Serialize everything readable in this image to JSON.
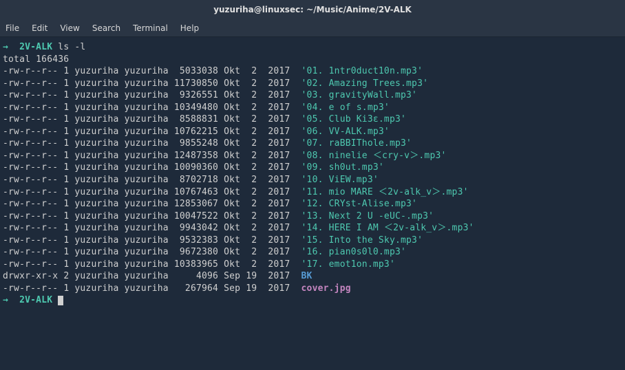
{
  "window": {
    "title": "yuzuriha@linuxsec: ~/Music/Anime/2V-ALK"
  },
  "menu": {
    "file": "File",
    "edit": "Edit",
    "view": "View",
    "search": "Search",
    "terminal": "Terminal",
    "help": "Help"
  },
  "prompt": {
    "arrow": "→",
    "dir": "2V-ALK",
    "cmd": "ls -l"
  },
  "total_line": "total 166436",
  "files": [
    {
      "perm": "-rw-r--r--",
      "links": "1",
      "owner": "yuzuriha",
      "group": "yuzuriha",
      "size": "5033038",
      "mon": "Okt",
      "day": "2",
      "year": "2017",
      "name": "'01. 1ntr0duct10n.mp3'",
      "kind": "file"
    },
    {
      "perm": "-rw-r--r--",
      "links": "1",
      "owner": "yuzuriha",
      "group": "yuzuriha",
      "size": "11730850",
      "mon": "Okt",
      "day": "2",
      "year": "2017",
      "name": "'02. Amazing Trees.mp3'",
      "kind": "file"
    },
    {
      "perm": "-rw-r--r--",
      "links": "1",
      "owner": "yuzuriha",
      "group": "yuzuriha",
      "size": "9326551",
      "mon": "Okt",
      "day": "2",
      "year": "2017",
      "name": "'03. gravityWall.mp3'",
      "kind": "file"
    },
    {
      "perm": "-rw-r--r--",
      "links": "1",
      "owner": "yuzuriha",
      "group": "yuzuriha",
      "size": "10349480",
      "mon": "Okt",
      "day": "2",
      "year": "2017",
      "name": "'04. e of s.mp3'",
      "kind": "file"
    },
    {
      "perm": "-rw-r--r--",
      "links": "1",
      "owner": "yuzuriha",
      "group": "yuzuriha",
      "size": "8588831",
      "mon": "Okt",
      "day": "2",
      "year": "2017",
      "name": "'05. Club Ki3ε.mp3'",
      "kind": "file"
    },
    {
      "perm": "-rw-r--r--",
      "links": "1",
      "owner": "yuzuriha",
      "group": "yuzuriha",
      "size": "10762215",
      "mon": "Okt",
      "day": "2",
      "year": "2017",
      "name": "'06. VV-ALK.mp3'",
      "kind": "file"
    },
    {
      "perm": "-rw-r--r--",
      "links": "1",
      "owner": "yuzuriha",
      "group": "yuzuriha",
      "size": "9855248",
      "mon": "Okt",
      "day": "2",
      "year": "2017",
      "name": "'07. raBBIThole.mp3'",
      "kind": "file"
    },
    {
      "perm": "-rw-r--r--",
      "links": "1",
      "owner": "yuzuriha",
      "group": "yuzuriha",
      "size": "12487358",
      "mon": "Okt",
      "day": "2",
      "year": "2017",
      "name": "'08. ninelie ＜cry-v＞.mp3'",
      "kind": "file"
    },
    {
      "perm": "-rw-r--r--",
      "links": "1",
      "owner": "yuzuriha",
      "group": "yuzuriha",
      "size": "10090360",
      "mon": "Okt",
      "day": "2",
      "year": "2017",
      "name": "'09. sh0ut.mp3'",
      "kind": "file"
    },
    {
      "perm": "-rw-r--r--",
      "links": "1",
      "owner": "yuzuriha",
      "group": "yuzuriha",
      "size": "8702718",
      "mon": "Okt",
      "day": "2",
      "year": "2017",
      "name": "'10. ViEW.mp3'",
      "kind": "file"
    },
    {
      "perm": "-rw-r--r--",
      "links": "1",
      "owner": "yuzuriha",
      "group": "yuzuriha",
      "size": "10767463",
      "mon": "Okt",
      "day": "2",
      "year": "2017",
      "name": "'11. mio MARE ＜2v-alk_v＞.mp3'",
      "kind": "file"
    },
    {
      "perm": "-rw-r--r--",
      "links": "1",
      "owner": "yuzuriha",
      "group": "yuzuriha",
      "size": "12853067",
      "mon": "Okt",
      "day": "2",
      "year": "2017",
      "name": "'12. CRYst-Alise.mp3'",
      "kind": "file"
    },
    {
      "perm": "-rw-r--r--",
      "links": "1",
      "owner": "yuzuriha",
      "group": "yuzuriha",
      "size": "10047522",
      "mon": "Okt",
      "day": "2",
      "year": "2017",
      "name": "'13. Next 2 U -eUC-.mp3'",
      "kind": "file"
    },
    {
      "perm": "-rw-r--r--",
      "links": "1",
      "owner": "yuzuriha",
      "group": "yuzuriha",
      "size": "9943042",
      "mon": "Okt",
      "day": "2",
      "year": "2017",
      "name": "'14. HERE I AM ＜2v-alk_v＞.mp3'",
      "kind": "file"
    },
    {
      "perm": "-rw-r--r--",
      "links": "1",
      "owner": "yuzuriha",
      "group": "yuzuriha",
      "size": "9532383",
      "mon": "Okt",
      "day": "2",
      "year": "2017",
      "name": "'15. Into the Sky.mp3'",
      "kind": "file"
    },
    {
      "perm": "-rw-r--r--",
      "links": "1",
      "owner": "yuzuriha",
      "group": "yuzuriha",
      "size": "9672380",
      "mon": "Okt",
      "day": "2",
      "year": "2017",
      "name": "'16. pian0s0l0.mp3'",
      "kind": "file"
    },
    {
      "perm": "-rw-r--r--",
      "links": "1",
      "owner": "yuzuriha",
      "group": "yuzuriha",
      "size": "10383965",
      "mon": "Okt",
      "day": "2",
      "year": "2017",
      "name": "'17. emot1on.mp3'",
      "kind": "file"
    },
    {
      "perm": "drwxr-xr-x",
      "links": "2",
      "owner": "yuzuriha",
      "group": "yuzuriha",
      "size": "4096",
      "mon": "Sep",
      "day": "19",
      "year": "2017",
      "name": "BK",
      "kind": "dir"
    },
    {
      "perm": "-rw-r--r--",
      "links": "1",
      "owner": "yuzuriha",
      "group": "yuzuriha",
      "size": "267964",
      "mon": "Sep",
      "day": "19",
      "year": "2017",
      "name": "cover.jpg",
      "kind": "img"
    }
  ]
}
